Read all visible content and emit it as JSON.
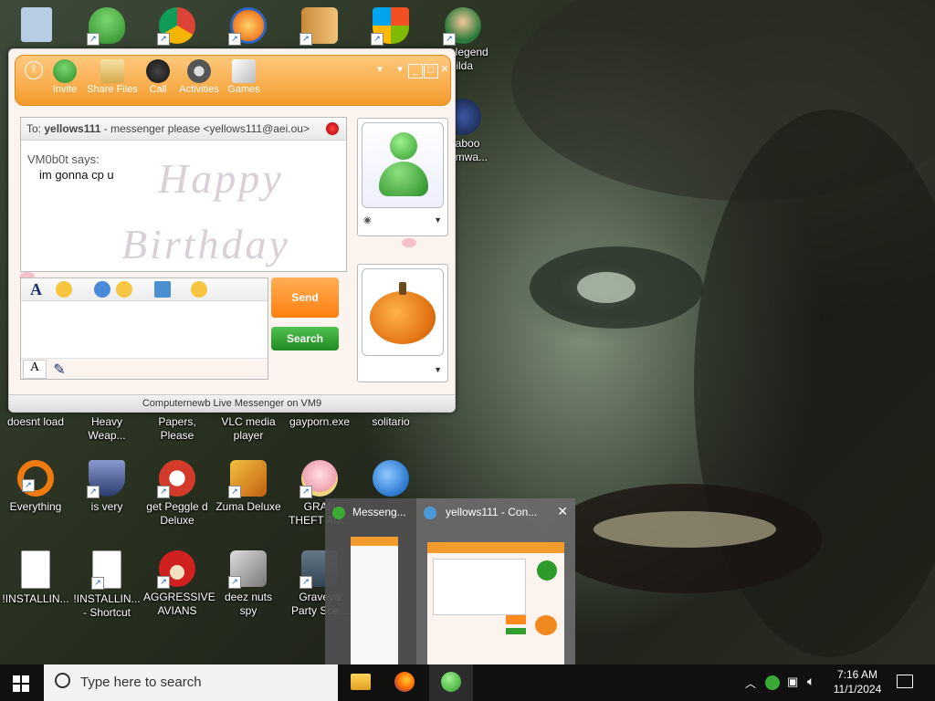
{
  "desktop": {
    "icons": [
      {
        "label": "",
        "icon": "recycle-bin-icon",
        "color": "#9fb8d8"
      },
      {
        "label": "",
        "icon": "messenger-buddy-icon",
        "color": "#3aaa35"
      },
      {
        "label": "",
        "icon": "chrome-icon",
        "color": "#db4437"
      },
      {
        "label": "",
        "icon": "peggle-icon",
        "color": "#f08a24"
      },
      {
        "label": "",
        "icon": "folder-zip-icon",
        "color": "#d89a3c"
      },
      {
        "label": "",
        "icon": "windows-shield-icon",
        "color": "#3c8ad8"
      },
      {
        "label": "_legend\nZilda",
        "icon": "zelda-icon",
        "color": "#2a7a3a"
      },
      {
        "label": "daboo\nomwa...",
        "icon": "shma-icon",
        "color": "#223a7a"
      },
      {
        "label": "doesnt load",
        "icon": "",
        "color": ""
      },
      {
        "label": "Heavy\nWeap...",
        "icon": "",
        "color": ""
      },
      {
        "label": "Papers, Please",
        "icon": "",
        "color": ""
      },
      {
        "label": "VLC media\nplayer",
        "icon": "",
        "color": ""
      },
      {
        "label": "gayporn.exe",
        "icon": "",
        "color": ""
      },
      {
        "label": "solitario",
        "icon": "",
        "color": ""
      },
      {
        "label": "Everything",
        "icon": "everything-search-icon",
        "color": "#f07a10"
      },
      {
        "label": "is very",
        "icon": "shield-emblem-icon",
        "color": "#5a6a9a"
      },
      {
        "label": "get Peggle d\nDeluxe",
        "icon": "peggle-icon",
        "color": "#d43a2a"
      },
      {
        "label": "Zuma Deluxe",
        "icon": "zuma-icon",
        "color": "#e0a020"
      },
      {
        "label": "GRAN\nTHEFT AU...",
        "icon": "anime-girl-icon",
        "color": "#f0b8c0"
      },
      {
        "label": "",
        "icon": "thunderbird-icon",
        "color": "#2a78d0"
      },
      {
        "label": "!INSTALLIN...",
        "icon": "document-icon",
        "color": "#ffffff"
      },
      {
        "label": "!INSTALLIN...\n- Shortcut",
        "icon": "document-icon",
        "color": "#ffffff"
      },
      {
        "label": "AGGRESSIVE\nAVIANS",
        "icon": "angry-bird-icon",
        "color": "#d02020"
      },
      {
        "label": "deez nuts spy",
        "icon": "windows-stack-icon",
        "color": "#9a9a9a"
      },
      {
        "label": "Graveya\nParty Sce...",
        "icon": "graveyard-icon",
        "color": "#556677"
      }
    ]
  },
  "messenger": {
    "toolbar": [
      {
        "label": "Invite",
        "icon": "invite-icon"
      },
      {
        "label": "Share Files",
        "icon": "share-files-icon"
      },
      {
        "label": "Call",
        "icon": "call-icon"
      },
      {
        "label": "Activities",
        "icon": "activities-icon"
      },
      {
        "label": "Games",
        "icon": "games-icon"
      }
    ],
    "to_prefix": "To:",
    "to_name": "yellows111",
    "to_detail": "- messenger please <yellows111@aei.ou>",
    "sender_line": "VM0b0t says:",
    "message": "im gonna cp u",
    "background_text_1": "Happy",
    "background_text_2": "Birthday",
    "send_label": "Send",
    "search_label": "Search",
    "status_text": "Computernewb Live Messenger on VM9",
    "colors": {
      "accent": "#f39b2c",
      "send": "#ff8a1c",
      "search": "#2f9e2f"
    }
  },
  "switcher": {
    "items": [
      {
        "title": "Messeng...",
        "icon": "messenger-buddy-icon"
      },
      {
        "title": "yellows111 - Con...",
        "icon": "messenger-conversation-icon"
      }
    ],
    "close_glyph": "✕"
  },
  "taskbar": {
    "search_placeholder": "Type here to search",
    "time": "7:16 AM",
    "date": "11/1/2024",
    "pinned": [
      "file-explorer-icon",
      "firefox-icon",
      "messenger-buddy-icon"
    ]
  }
}
